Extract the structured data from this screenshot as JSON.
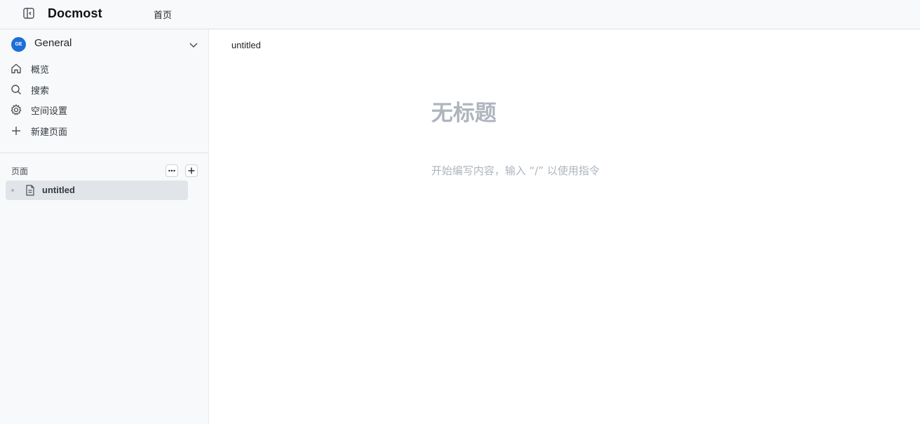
{
  "header": {
    "brand": "Docmost",
    "home_label": "首页"
  },
  "sidebar": {
    "space": {
      "avatar_initials": "GE",
      "avatar_color": "#1c6fd9",
      "name": "General"
    },
    "nav": [
      {
        "label": "概览",
        "icon": "home-icon"
      },
      {
        "label": "搜索",
        "icon": "search-icon"
      },
      {
        "label": "空间设置",
        "icon": "gear-icon"
      },
      {
        "label": "新建页面",
        "icon": "plus-icon"
      }
    ],
    "pages_section": {
      "title": "页面",
      "tree": [
        {
          "label": "untitled",
          "icon": "page-icon"
        }
      ]
    }
  },
  "main": {
    "breadcrumb": "untitled",
    "title_placeholder": "无标题",
    "body_placeholder": "开始编写内容，输入 “/” 以使用指令"
  }
}
